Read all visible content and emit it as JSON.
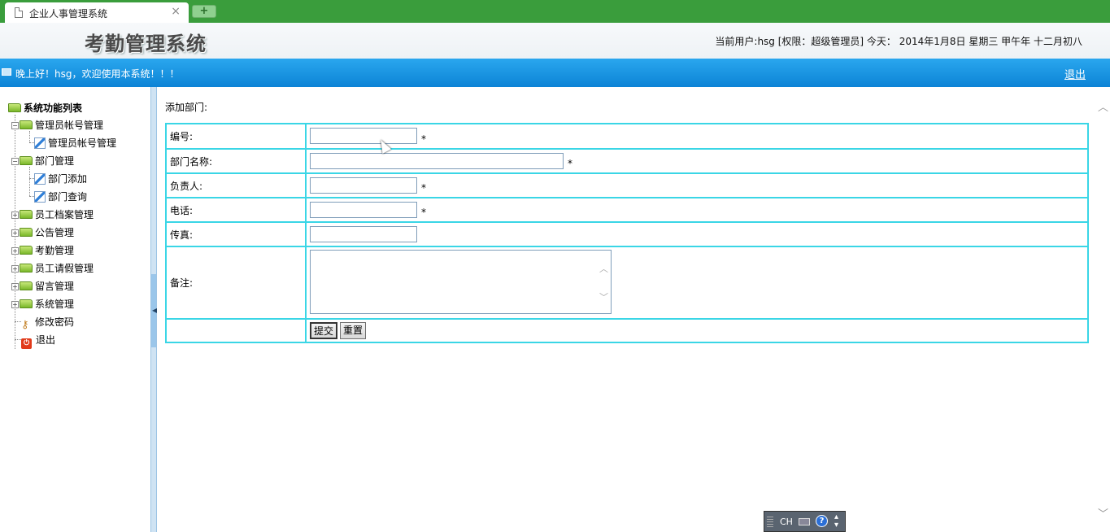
{
  "browser": {
    "tab_title": "企业人事管理系统",
    "close_glyph": "×",
    "new_tab_glyph": "+"
  },
  "header": {
    "logo_text": "考勤管理系统",
    "user_info": "当前用户:hsg [权限：超级管理员] 今天： 2014年1月8日 星期三 甲午年 十二月初八"
  },
  "bar": {
    "greeting": "晚上好！hsg，欢迎使用本系统！！！",
    "logout": "退出"
  },
  "nav": {
    "root": "系统功能列表",
    "items": [
      {
        "label": "管理员帐号管理"
      },
      {
        "label": "管理员帐号管理"
      },
      {
        "label": "部门管理"
      },
      {
        "label": "部门添加"
      },
      {
        "label": "部门查询"
      },
      {
        "label": "员工档案管理"
      },
      {
        "label": "公告管理"
      },
      {
        "label": "考勤管理"
      },
      {
        "label": "员工请假管理"
      },
      {
        "label": "留言管理"
      },
      {
        "label": "系统管理"
      },
      {
        "label": "修改密码"
      },
      {
        "label": "退出"
      }
    ],
    "plus_glyph": "+",
    "minus_glyph": "−"
  },
  "form": {
    "title": "添加部门:",
    "required_mark": "*",
    "fields": {
      "id_label": "编号:",
      "name_label": "部门名称:",
      "manager_label": "负责人:",
      "phone_label": "电话:",
      "fax_label": "传真:",
      "remark_label": "备注:"
    },
    "submit": "提交",
    "reset": "重置"
  },
  "ime": {
    "lang": "CH",
    "help": "?"
  },
  "icons": {
    "folder": "folder-icon",
    "edit": "edit-page-icon",
    "key": "key-icon",
    "power": "power-icon"
  },
  "colors": {
    "tabbar": "#3a9d3c",
    "bluebar": "#1596e2",
    "table_border": "#3ad6e6"
  }
}
